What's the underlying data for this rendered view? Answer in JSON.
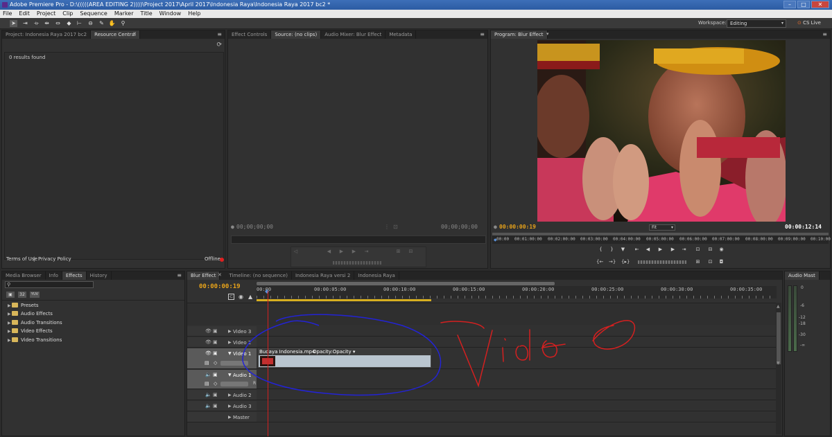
{
  "window": {
    "title": "Adobe Premiere Pro - D:\\(((((AREA EDITING 2))))\\Project 2017\\April 2017\\Indonesia Raya\\Indonesia Raya 2017 bc2 *",
    "buttons": [
      "–",
      "□",
      "✕"
    ]
  },
  "menu": [
    "File",
    "Edit",
    "Project",
    "Clip",
    "Sequence",
    "Marker",
    "Title",
    "Window",
    "Help"
  ],
  "toolbar": {
    "tools": [
      "selection-tool",
      "track-select-tool",
      "ripple-edit-tool",
      "rolling-edit-tool",
      "rate-stretch-tool",
      "razor-tool",
      "slip-tool",
      "slide-tool",
      "pen-tool",
      "hand-tool",
      "zoom-tool"
    ],
    "workspace_label": "Workspace:",
    "workspace_value": "Editing",
    "cs_live": "CS Live"
  },
  "project_panel": {
    "tabs": [
      "Project: Indonesia Raya 2017 bc2",
      "Resource Central"
    ],
    "results": "0 results found",
    "terms": "Terms of Use",
    "privacy": "Privacy Policy",
    "separator": "|",
    "status": "Offline"
  },
  "source_panel": {
    "tabs": [
      "Effect Controls",
      "Source: (no clips)",
      "Audio Mixer: Blur Effect",
      "Metadata"
    ],
    "timecode_left": "00;00;00;00",
    "timecode_right": "00;00;00;00"
  },
  "program_panel": {
    "tab": "Program: Blur Effect",
    "timecode_current": "00:00:00:19",
    "fit": "Fit",
    "timecode_duration": "00:00:12:14",
    "ruler": [
      "00:00",
      "00:01:00:00",
      "00:02:00:00",
      "00:03:00:00",
      "00:04:00:00",
      "00:05:00:00",
      "00:06:00:00",
      "00:07:00:00",
      "00:08:00:00",
      "00:09:00:00",
      "00:10:00"
    ]
  },
  "effects_panel": {
    "tabs": [
      "Media Browser",
      "Info",
      "Effects",
      "History"
    ],
    "folders": [
      "Presets",
      "Audio Effects",
      "Audio Transitions",
      "Video Effects",
      "Video Transitions"
    ],
    "icon_badges": [
      "32",
      "YUV"
    ]
  },
  "timeline": {
    "tabs": [
      "Blur Effect",
      "Timeline: (no sequence)",
      "Indonesia Raya versi 2",
      "Indonesia Raya"
    ],
    "timecode": "00:00:00:19",
    "ruler": [
      "00:00",
      "00:00:05:00",
      "00:00:10:00",
      "00:00:15:00",
      "00:00:20:00",
      "00:00:25:00",
      "00:00:30:00",
      "00:00:35:00"
    ],
    "tracks": [
      "Video 3",
      "Video 2",
      "Video 1",
      "Audio 1",
      "Audio 2",
      "Audio 3",
      "Master"
    ],
    "audio1_mark": "R",
    "clip_name": "Budaya Indonesia.mp4",
    "clip_fx": "Opacity:Opacity ▾",
    "annotation_text": "Video"
  },
  "audio_master": {
    "title": "Audio Mast",
    "scale": [
      "0",
      "-6",
      "-12",
      "-18",
      "-30",
      "-∞"
    ]
  },
  "colors": {
    "accent_timecode": "#e8a31a",
    "titlebar": "#2c5ca3",
    "annotation_red": "#d42020",
    "annotation_blue": "#2323d6"
  }
}
